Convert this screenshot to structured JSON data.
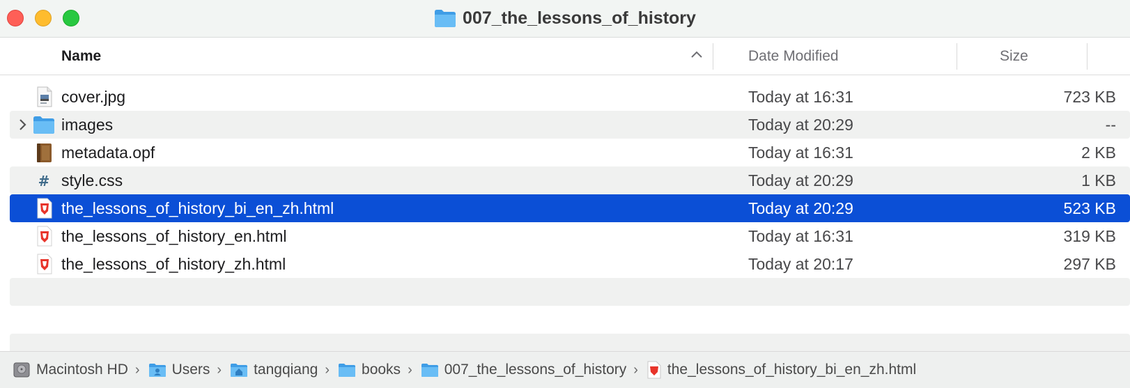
{
  "window": {
    "title": "007_the_lessons_of_history"
  },
  "columns": {
    "name": "Name",
    "date_modified": "Date Modified",
    "size": "Size"
  },
  "files": [
    {
      "name": "cover.jpg",
      "date": "Today at 16:31",
      "size": "723 KB",
      "icon": "image-file-icon"
    },
    {
      "name": "images",
      "date": "Today at 20:29",
      "size": "--",
      "icon": "folder-icon"
    },
    {
      "name": "metadata.opf",
      "date": "Today at 16:31",
      "size": "2 KB",
      "icon": "book-icon"
    },
    {
      "name": "style.css",
      "date": "Today at 20:29",
      "size": "1 KB",
      "icon": "css-file-icon"
    },
    {
      "name": "the_lessons_of_history_bi_en_zh.html",
      "date": "Today at 20:29",
      "size": "523 KB",
      "icon": "html-file-icon",
      "selected": true
    },
    {
      "name": "the_lessons_of_history_en.html",
      "date": "Today at 16:31",
      "size": "319 KB",
      "icon": "html-file-icon"
    },
    {
      "name": "the_lessons_of_history_zh.html",
      "date": "Today at 20:17",
      "size": "297 KB",
      "icon": "html-file-icon"
    }
  ],
  "path_bar": {
    "items": [
      {
        "label": "Macintosh HD",
        "icon": "hard-drive-icon"
      },
      {
        "label": "Users",
        "icon": "users-folder-icon"
      },
      {
        "label": "tangqiang",
        "icon": "home-folder-icon"
      },
      {
        "label": "books",
        "icon": "folder-icon"
      },
      {
        "label": "007_the_lessons_of_history",
        "icon": "folder-icon"
      },
      {
        "label": "the_lessons_of_history_bi_en_zh.html",
        "icon": "html-file-icon"
      }
    ]
  },
  "colors": {
    "selection": "#0b4fd6",
    "folder": "#5ab5f3",
    "close": "#fe5f57",
    "minimize": "#febc2e",
    "maximize": "#28c840"
  }
}
